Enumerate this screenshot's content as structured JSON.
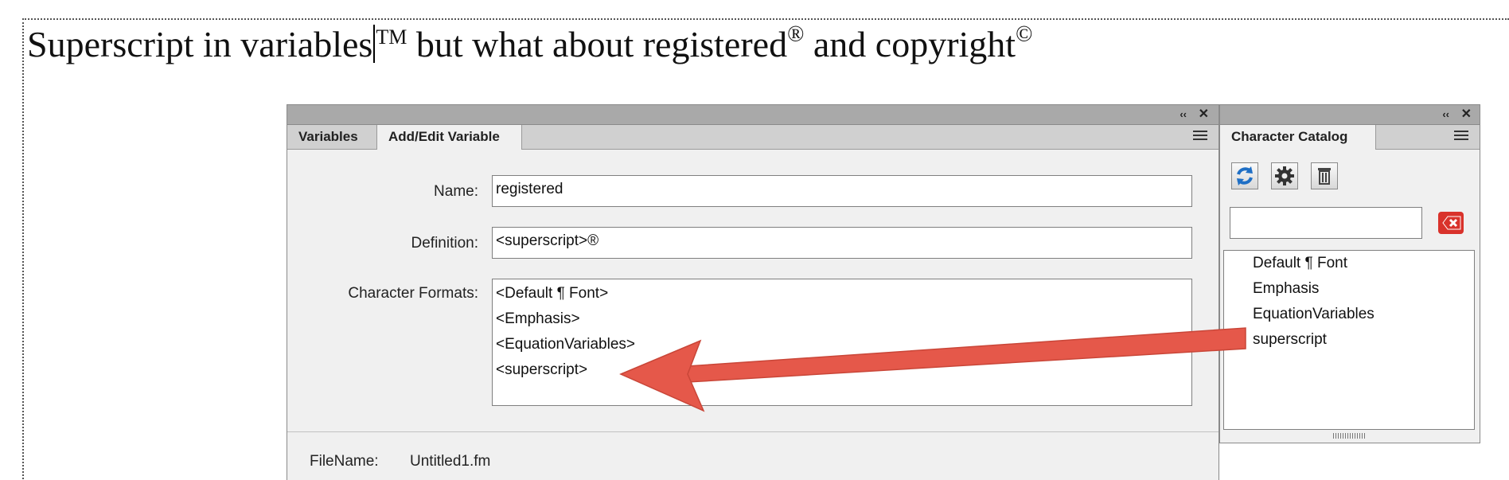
{
  "document": {
    "text_before_caret": "Superscript in variables",
    "tm": "TM",
    "text_mid": " but what about registered",
    "reg": "®",
    "text_end": " and copyright",
    "copy": "©"
  },
  "variable_panel": {
    "tabs": [
      "Variables",
      "Add/Edit Variable"
    ],
    "active_tab": "Add/Edit Variable",
    "name_label": "Name:",
    "name_value": "registered",
    "definition_label": "Definition:",
    "definition_value": "<superscript>®",
    "formats_label": "Character Formats:",
    "formats": [
      "<Default ¶ Font>",
      "<Emphasis>",
      "<EquationVariables>",
      "<superscript>"
    ],
    "filename_label": "FileName:",
    "filename_value": "Untitled1.fm"
  },
  "catalog_panel": {
    "tab": "Character Catalog",
    "search_value": "",
    "items": [
      "Default ¶ Font",
      "Emphasis",
      "EquationVariables",
      "superscript"
    ]
  },
  "annotation": {
    "arrow_color": "#e5584a"
  },
  "icons": [
    "collapse-icon",
    "close-icon",
    "panel-menu-icon",
    "refresh-icon",
    "gear-icon",
    "delete-icon",
    "clear-search-icon"
  ]
}
